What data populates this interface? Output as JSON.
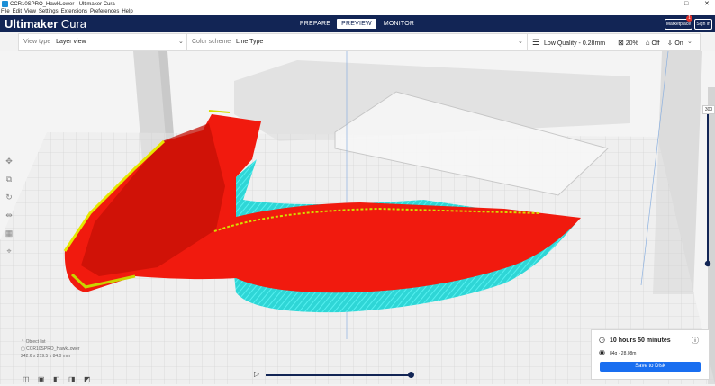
{
  "window": {
    "title": "CCR10SPRO_HawkLower - Ultimaker Cura",
    "minimize": "–",
    "maximize": "□",
    "close": "✕"
  },
  "menu": [
    "File",
    "Edit",
    "View",
    "Settings",
    "Extensions",
    "Preferences",
    "Help"
  ],
  "header": {
    "logo_brand": "Ultimaker",
    "logo_product": " Cura",
    "stages": [
      {
        "label": "PREPARE",
        "active": false
      },
      {
        "label": "PREVIEW",
        "active": true
      },
      {
        "label": "MONITOR",
        "active": false
      }
    ],
    "marketplace_label": "Marketplace",
    "marketplace_badge": "1",
    "signin_label": "Sign in"
  },
  "toolbar": {
    "view_type_label": "View type",
    "view_type_value": "Layer view",
    "color_scheme_label": "Color scheme",
    "color_scheme_value": "Line Type",
    "quality": "Low Quality - 0.28mm",
    "infill": "20%",
    "support": "Off",
    "adhesion": "On"
  },
  "object": {
    "list_label": "Object list",
    "name": "CCR10SPRO_HawkLower",
    "dimensions": "242.6 x 219.5 x 84.0 mm"
  },
  "layer_slider": {
    "top_value": "300"
  },
  "print_info": {
    "time": "10 hours 50 minutes",
    "material": "84g · 28.08m",
    "save_label": "Save to Disk"
  },
  "icons": {
    "move": "move-icon",
    "scale": "scale-icon",
    "rotate": "rotate-icon",
    "mirror": "mirror-icon",
    "per-model": "per-model-settings-icon",
    "support-blocker": "support-blocker-icon"
  },
  "colors": {
    "header": "#122555",
    "model_wall": "#ff0000",
    "skirt": "#35e0e0",
    "infill": "#e8e800",
    "save_button": "#196ef0"
  }
}
